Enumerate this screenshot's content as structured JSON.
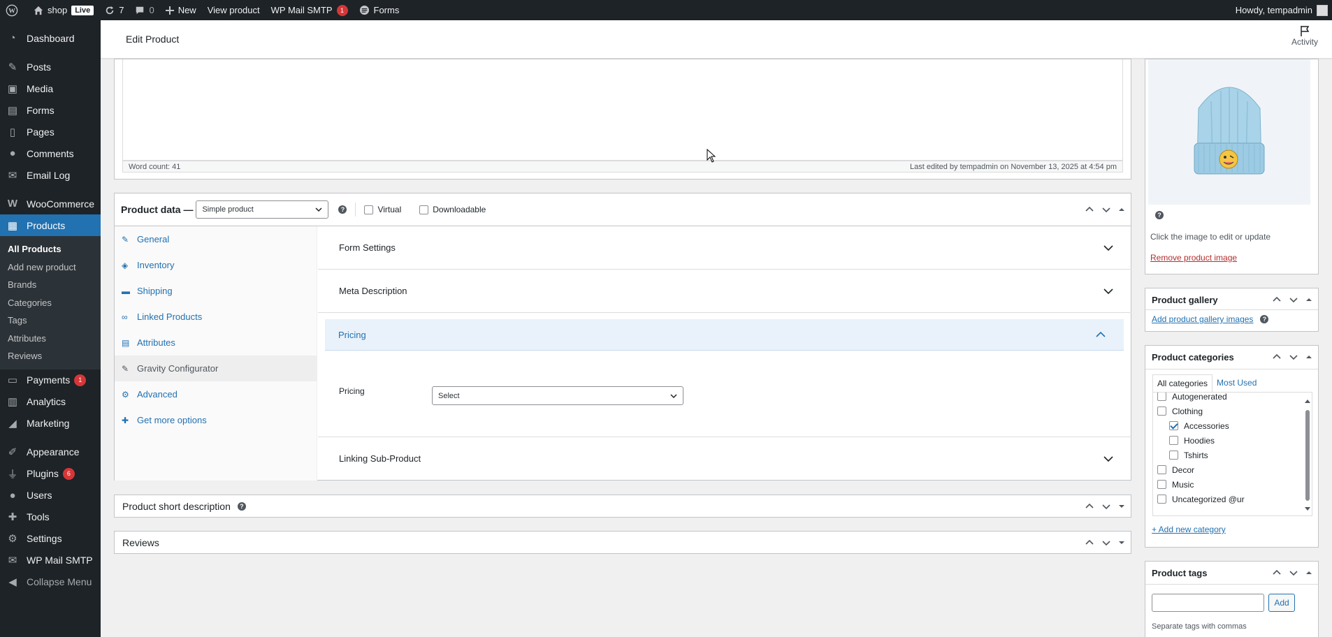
{
  "admin_bar": {
    "site_name": "shop",
    "live_badge": "Live",
    "updates_count": "7",
    "comments_count": "0",
    "new_label": "New",
    "view_product_label": "View product",
    "smtp_label": "WP Mail SMTP",
    "smtp_count": "1",
    "forms_label": "Forms",
    "howdy": "Howdy, tempadmin"
  },
  "sidebar": {
    "items": [
      {
        "label": "Dashboard",
        "icon": "dashboard-icon"
      },
      {
        "label": "Posts",
        "icon": "pin-icon"
      },
      {
        "label": "Media",
        "icon": "media-icon"
      },
      {
        "label": "Forms",
        "icon": "forms-icon"
      },
      {
        "label": "Pages",
        "icon": "pages-icon"
      },
      {
        "label": "Comments",
        "icon": "comments-icon"
      },
      {
        "label": "Email Log",
        "icon": "email-icon"
      },
      {
        "label": "WooCommerce",
        "icon": "woocommerce-icon"
      },
      {
        "label": "Products",
        "icon": "products-icon"
      },
      {
        "label": "Payments",
        "icon": "payments-icon",
        "count": "1"
      },
      {
        "label": "Analytics",
        "icon": "analytics-icon"
      },
      {
        "label": "Marketing",
        "icon": "marketing-icon"
      },
      {
        "label": "Appearance",
        "icon": "appearance-icon"
      },
      {
        "label": "Plugins",
        "icon": "plugins-icon",
        "count": "6"
      },
      {
        "label": "Users",
        "icon": "users-icon"
      },
      {
        "label": "Tools",
        "icon": "tools-icon"
      },
      {
        "label": "Settings",
        "icon": "settings-icon"
      },
      {
        "label": "WP Mail SMTP",
        "icon": "smtp-icon"
      },
      {
        "label": "Collapse Menu",
        "icon": "collapse-icon"
      }
    ],
    "submenu": [
      "All Products",
      "Add new product",
      "Brands",
      "Categories",
      "Tags",
      "Attributes",
      "Reviews"
    ]
  },
  "header": {
    "title": "Edit Product",
    "activity_label": "Activity"
  },
  "editor": {
    "word_count": "Word count: 41",
    "last_edited": "Last edited by tempadmin on November 13, 2025 at 4:54 pm"
  },
  "product_data": {
    "title": "Product data —",
    "type_value": "Simple product",
    "virtual_label": "Virtual",
    "downloadable_label": "Downloadable",
    "tabs": [
      "General",
      "Inventory",
      "Shipping",
      "Linked Products",
      "Attributes",
      "Gravity Configurator",
      "Advanced",
      "Get more options"
    ],
    "sections": {
      "form_settings": "Form Settings",
      "meta_description": "Meta Description",
      "pricing": "Pricing",
      "pricing_field_label": "Pricing",
      "pricing_select_value": "Select",
      "linking_sub_product": "Linking Sub-Product"
    }
  },
  "short_description": {
    "title": "Product short description"
  },
  "reviews": {
    "title": "Reviews"
  },
  "product_image": {
    "hint": "Click the image to edit or update",
    "remove_link": "Remove product image"
  },
  "gallery": {
    "title": "Product gallery",
    "add_link": "Add product gallery images"
  },
  "categories": {
    "title": "Product categories",
    "tab_all": "All categories",
    "tab_most_used": "Most Used",
    "items": [
      {
        "label": "Autogenerated",
        "checked": false,
        "child": false
      },
      {
        "label": "Clothing",
        "checked": false,
        "child": false
      },
      {
        "label": "Accessories",
        "checked": true,
        "child": true
      },
      {
        "label": "Hoodies",
        "checked": false,
        "child": true
      },
      {
        "label": "Tshirts",
        "checked": false,
        "child": true
      },
      {
        "label": "Decor",
        "checked": false,
        "child": false
      },
      {
        "label": "Music",
        "checked": false,
        "child": false
      },
      {
        "label": "Uncategorized @ur",
        "checked": false,
        "child": false
      }
    ],
    "add_new_link": "+ Add new category"
  },
  "tags": {
    "title": "Product tags",
    "add_button": "Add",
    "input_value": "",
    "hint": "Separate tags with commas"
  },
  "colors": {
    "admin_dark": "#1d2327",
    "accent": "#2271b1",
    "badge_red": "#d63638"
  }
}
